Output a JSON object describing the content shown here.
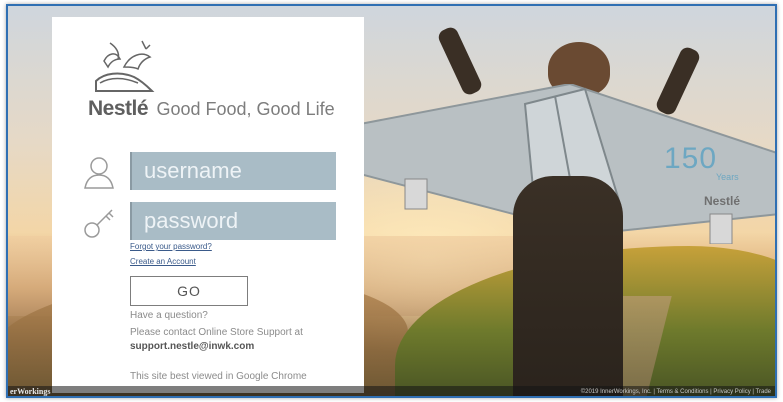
{
  "brand": {
    "name": "Nestlé",
    "tagline": "Good Food, Good Life"
  },
  "login": {
    "username_placeholder": "username",
    "password_placeholder": "password",
    "forgot_link": "Forgot your password?",
    "create_link": "Create an Account",
    "go_label": "GO"
  },
  "help": {
    "question": "Have a question?",
    "contact": "Please contact Online Store Support at",
    "email": "support.nestle@inwk.com",
    "browser_note": "This site best viewed in Google Chrome"
  },
  "anniversary": {
    "number": "150",
    "years": "Years",
    "mark": "Nestlé"
  },
  "footer": {
    "brand": "erWorkings",
    "legal": "©2019 InnerWorkings, Inc. | Terms & Conditions | Privacy Policy | Trade"
  },
  "colors": {
    "input_bg": "#a9bcc6",
    "frame_border": "#2f6fb3"
  }
}
